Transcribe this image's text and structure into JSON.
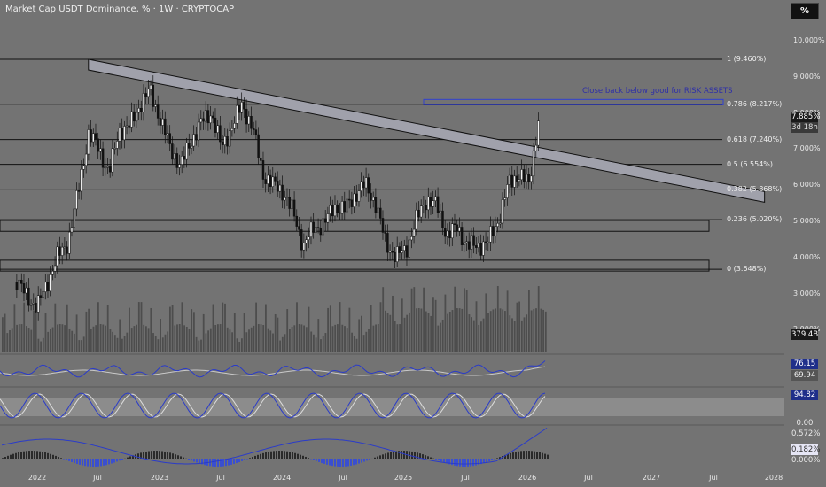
{
  "header": {
    "title": "Market Cap USDT Dominance, % · 1W · CRYPTOCAP",
    "scale_button": "%"
  },
  "colors": {
    "background": "#737373",
    "line": "#000000",
    "accent": "#2a3bc9",
    "band": "#9fa0aa"
  },
  "price_axis": [
    "10.000%",
    "9.000%",
    "8.000%",
    "7.000%",
    "6.000%",
    "5.000%",
    "4.000%",
    "3.000%",
    "2.000%"
  ],
  "price_tag": {
    "value": "7.885%",
    "countdown": "3d 18h"
  },
  "volume_tag": "379.4B",
  "rsi_tags": [
    "76.15",
    "69.94"
  ],
  "stoch_tags": [
    "94.82",
    "0.00"
  ],
  "macd_tags": [
    "0.572%",
    "0.182%",
    "0.000%"
  ],
  "time_axis": [
    "2022",
    "Jul",
    "2023",
    "Jul",
    "2024",
    "Jul",
    "2025",
    "Jul",
    "2026",
    "Jul",
    "2027",
    "Jul",
    "2028"
  ],
  "annotation": "Close back below good for RISK ASSETS",
  "chart_data": {
    "type": "candlestick",
    "title": "Market Cap USDT Dominance, % · 1W · CRYPTOCAP",
    "ylim": [
      2.2,
      10.4
    ],
    "fib_levels": [
      {
        "label": "1 (9.460%)",
        "value": 9.46
      },
      {
        "label": "0.786 (8.217%)",
        "value": 8.217
      },
      {
        "label": "0.618 (7.240%)",
        "value": 7.24
      },
      {
        "label": "0.5 (6.554%)",
        "value": 6.554
      },
      {
        "label": "0.382 (5.868%)",
        "value": 5.868
      },
      {
        "label": "0.236 (5.020%)",
        "value": 5.02
      },
      {
        "label": "0 (3.648%)",
        "value": 3.648
      }
    ],
    "close_path": [
      [
        "2021-11",
        3.3
      ],
      [
        "2021-12",
        2.9
      ],
      [
        "2022-01",
        2.6
      ],
      [
        "2022-02",
        3.3
      ],
      [
        "2022-03",
        4.0
      ],
      [
        "2022-04",
        4.4
      ],
      [
        "2022-05",
        5.8
      ],
      [
        "2022-06",
        7.4
      ],
      [
        "2022-07",
        7.0
      ],
      [
        "2022-08",
        6.3
      ],
      [
        "2022-09",
        7.5
      ],
      [
        "2022-10",
        7.6
      ],
      [
        "2022-11",
        8.2
      ],
      [
        "2022-12",
        8.6
      ],
      [
        "2023-01",
        7.8
      ],
      [
        "2023-02",
        7.0
      ],
      [
        "2023-03",
        6.5
      ],
      [
        "2023-04",
        7.2
      ],
      [
        "2023-05",
        7.7
      ],
      [
        "2023-06",
        8.0
      ],
      [
        "2023-07",
        7.0
      ],
      [
        "2023-08",
        7.6
      ],
      [
        "2023-09",
        8.2
      ],
      [
        "2023-10",
        7.6
      ],
      [
        "2023-11",
        6.3
      ],
      [
        "2023-12",
        6.0
      ],
      [
        "2024-01",
        5.8
      ],
      [
        "2024-02",
        5.2
      ],
      [
        "2024-03",
        4.3
      ],
      [
        "2024-04",
        4.8
      ],
      [
        "2024-05",
        4.9
      ],
      [
        "2024-06",
        5.4
      ],
      [
        "2024-07",
        5.3
      ],
      [
        "2024-08",
        5.7
      ],
      [
        "2024-09",
        6.0
      ],
      [
        "2024-10",
        5.5
      ],
      [
        "2024-11",
        4.4
      ],
      [
        "2024-12",
        4.0
      ],
      [
        "2025-01",
        4.2
      ],
      [
        "2025-02",
        5.0
      ],
      [
        "2025-03",
        5.6
      ],
      [
        "2025-04",
        5.4
      ],
      [
        "2025-05",
        4.6
      ],
      [
        "2025-06",
        4.8
      ],
      [
        "2025-07",
        4.3
      ],
      [
        "2025-08",
        4.3
      ],
      [
        "2025-09",
        4.4
      ],
      [
        "2025-10",
        5.0
      ],
      [
        "2025-11",
        6.0
      ],
      [
        "2025-12",
        6.3
      ],
      [
        "2026-01",
        6.0
      ],
      [
        "2026-02",
        7.9
      ]
    ],
    "descending_resistance": {
      "from": [
        "2022-06",
        9.46
      ],
      "to": [
        "2027-12",
        5.8
      ]
    },
    "support_zones": [
      [
        4.7,
        5.0
      ],
      [
        3.6,
        3.9
      ]
    ],
    "highlight_zone": [
      8.2,
      8.35
    ]
  }
}
